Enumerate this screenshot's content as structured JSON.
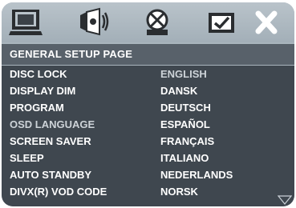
{
  "header": {
    "title": "GENERAL SETUP PAGE"
  },
  "icons": [
    "general-setup-icon",
    "audio-setup-icon",
    "video-setup-icon",
    "preference-setup-icon",
    "exit-setup-icon"
  ],
  "menu_items": [
    "DISC LOCK",
    "DISPLAY DIM",
    "PROGRAM",
    "OSD LANGUAGE",
    "SCREEN SAVER",
    "SLEEP",
    "AUTO STANDBY",
    "DIVX(R) VOD CODE"
  ],
  "selected_menu_item": "OSD LANGUAGE",
  "language_options": [
    "ENGLISH",
    "DANSK",
    "DEUTSCH",
    "ESPAÑOL",
    "FRANÇAIS",
    "ITALIANO",
    "NEDERLANDS",
    "NORSK"
  ],
  "selected_language": "ENGLISH",
  "colors": {
    "icon_bar": "#a9b5bd",
    "header_bg": "#58616a",
    "menu_bg": "#3f474f",
    "text": "#ffffff",
    "highlight_text": "#cdd3d8"
  }
}
